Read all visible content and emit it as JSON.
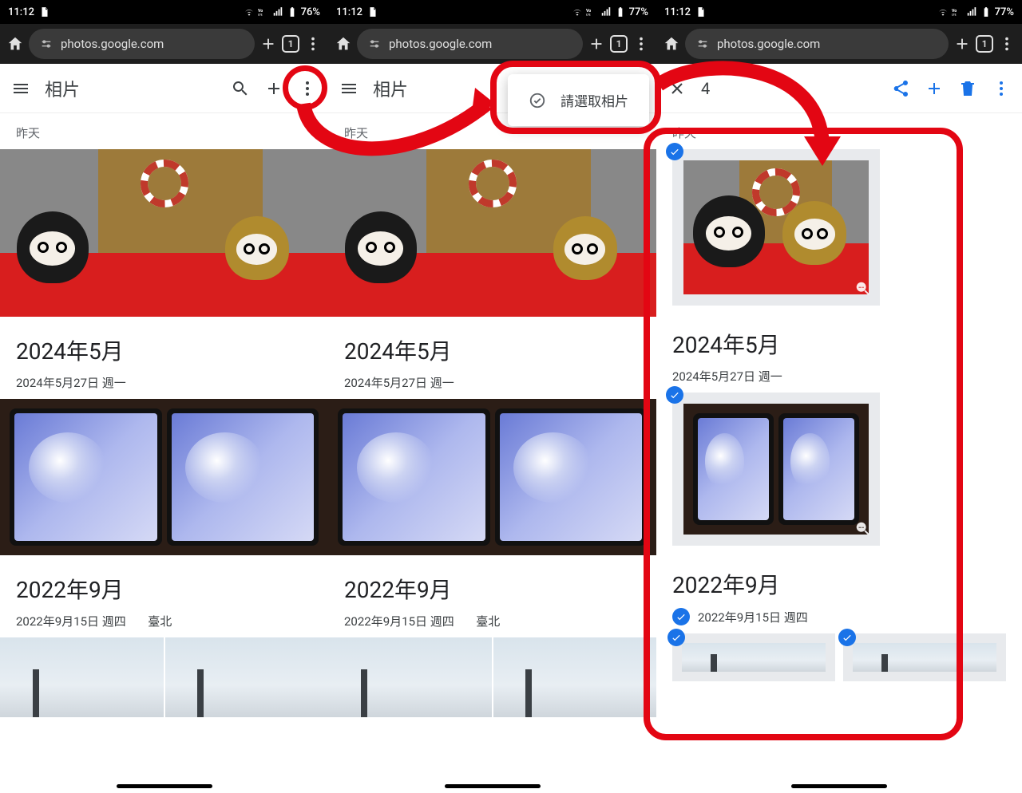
{
  "colors": {
    "annotate": "#e30613",
    "accent": "#1a73e8"
  },
  "status": {
    "time": "11:12",
    "battery1": "76%",
    "battery2": "77%",
    "battery3": "77%"
  },
  "browser": {
    "url": "photos.google.com",
    "tab_count": "1"
  },
  "app": {
    "title": "相片",
    "selection_count": "4"
  },
  "popup": {
    "text": "請選取相片"
  },
  "sections": {
    "yesterday_label": "昨天",
    "month_may": "2024年5月",
    "date_may": "2024年5月27日 週一",
    "month_sep": "2022年9月",
    "date_sep": "2022年9月15日 週四",
    "location_sep": "臺北"
  }
}
